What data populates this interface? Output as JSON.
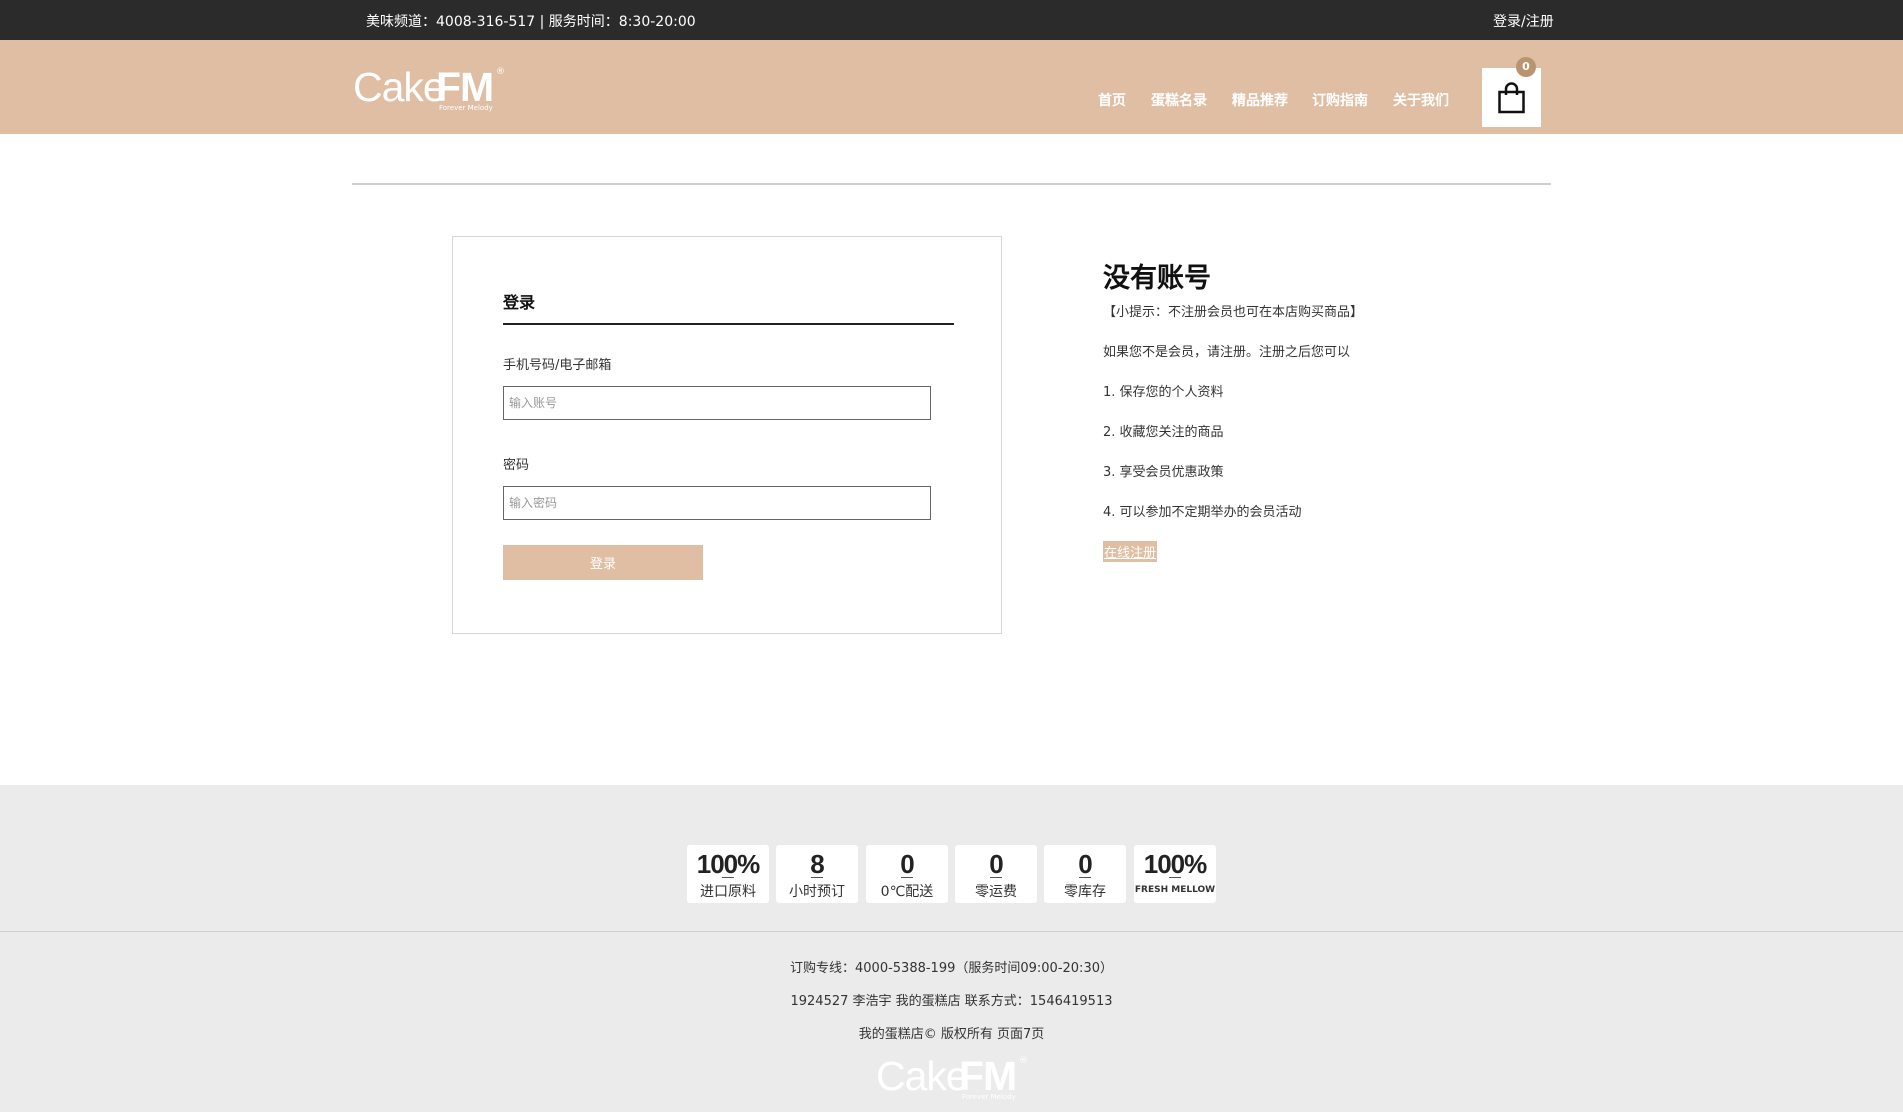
{
  "topbar": {
    "hotline": "美味频道：4008-316-517 | 服务时间：8:30-20:00",
    "login_register": "登录/注册"
  },
  "header": {
    "logo": {
      "cake": "Cake",
      "fm": "FM",
      "reg": "®",
      "tagline": "Forever Melody"
    },
    "nav": [
      "首页",
      "蛋糕名录",
      "精品推荐",
      "订购指南",
      "关于我们"
    ],
    "cart_count": "0",
    "cart_icon": "shopping-bag-icon"
  },
  "login": {
    "title": "登录",
    "account_label": "手机号码/电子邮箱",
    "account_placeholder": "输入账号",
    "password_label": "密码",
    "password_placeholder": "输入密码",
    "submit": "登录"
  },
  "register_info": {
    "title": "没有账号",
    "tip": "【小提示：不注册会员也可在本店购买商品】",
    "intro": "如果您不是会员，请注册。注册之后您可以",
    "benefits": [
      "1. 保存您的个人资料",
      "2. 收藏您关注的商品",
      "3. 享受会员优惠政策",
      "4. 可以参加不定期举办的会员活动"
    ],
    "register_link": "在线注册"
  },
  "features": [
    {
      "big": "100%",
      "small": "进口原料"
    },
    {
      "big": "8",
      "small": "小时预订"
    },
    {
      "big": "0",
      "small": "0℃配送"
    },
    {
      "big": "0",
      "small": "零运费"
    },
    {
      "big": "0",
      "small": "零库存"
    },
    {
      "big": "100%",
      "small": "FRESH MELLOW"
    }
  ],
  "footer": {
    "order_line": "订购专线：4000-5388-199（服务时间09:00-20:30）",
    "contact_line": "1924527 李浩宇 我的蛋糕店 联系方式：1546419513",
    "copyright_line": "我的蛋糕店© 版权所有 页面7页",
    "logo": {
      "cake": "Cake",
      "fm": "FM",
      "reg": "®",
      "tagline": "Forever Melody"
    }
  },
  "colors": {
    "accent": "#dfbea3",
    "topbar": "#2b2b2b",
    "footer_bg": "#ebebeb",
    "badge": "#b89570"
  }
}
